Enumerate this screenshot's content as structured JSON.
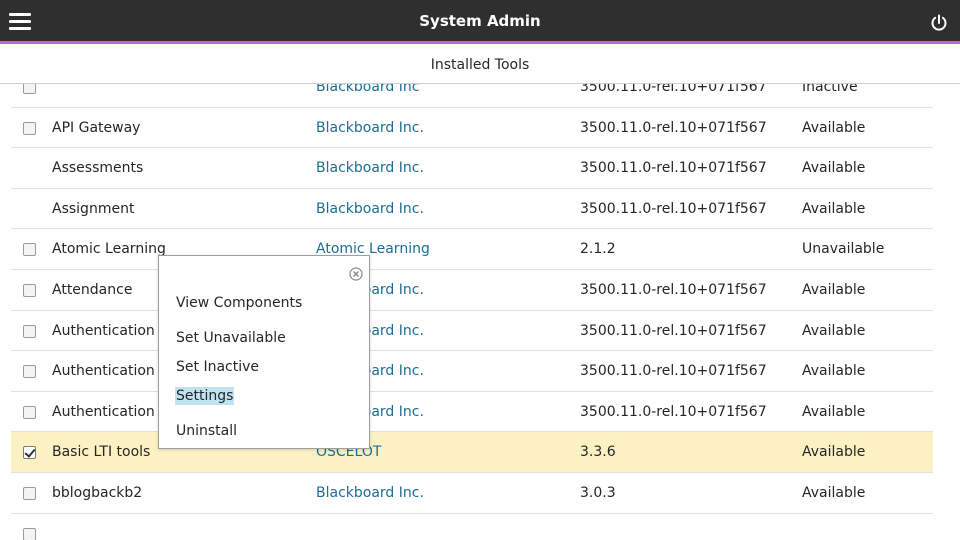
{
  "header": {
    "title": "System Admin",
    "menu_icon": "hamburger-menu-icon",
    "power_icon": "power-icon",
    "bg_color": "#2f2f2f",
    "accent_color": "#b36bd0"
  },
  "subheader": {
    "title": "Installed Tools"
  },
  "table": {
    "rows": [
      {
        "name": "",
        "vendor": "Blackboard Inc",
        "version": "3500.11.0-rel.10+071f567",
        "status": "Inactive",
        "has_checkbox": true,
        "checked": false
      },
      {
        "name": "API Gateway",
        "vendor": "Blackboard Inc.",
        "version": "3500.11.0-rel.10+071f567",
        "status": "Available",
        "has_checkbox": true,
        "checked": false
      },
      {
        "name": "Assessments",
        "vendor": "Blackboard Inc.",
        "version": "3500.11.0-rel.10+071f567",
        "status": "Available",
        "has_checkbox": false,
        "checked": false
      },
      {
        "name": "Assignment",
        "vendor": "Blackboard Inc.",
        "version": "3500.11.0-rel.10+071f567",
        "status": "Available",
        "has_checkbox": false,
        "checked": false
      },
      {
        "name": "Atomic Learning",
        "vendor": "Atomic Learning",
        "version": "2.1.2",
        "status": "Unavailable",
        "has_checkbox": true,
        "checked": false
      },
      {
        "name": "Attendance",
        "vendor": "Blackboard Inc.",
        "version": "3500.11.0-rel.10+071f567",
        "status": "Available",
        "has_checkbox": true,
        "checked": false
      },
      {
        "name": "Authentication P",
        "vendor": "Blackboard Inc.",
        "version": "3500.11.0-rel.10+071f567",
        "status": "Available",
        "has_checkbox": true,
        "checked": false
      },
      {
        "name": "Authentication P",
        "vendor": "Blackboard Inc.",
        "version": "3500.11.0-rel.10+071f567",
        "status": "Available",
        "has_checkbox": true,
        "checked": false
      },
      {
        "name": "Authentication P",
        "vendor": "Blackboard Inc.",
        "version": "3500.11.0-rel.10+071f567",
        "status": "Available",
        "has_checkbox": true,
        "checked": false
      },
      {
        "name": "Basic LTI tools",
        "vendor": "OSCELOT",
        "version": "3.3.6",
        "status": "Available",
        "has_checkbox": true,
        "checked": true,
        "selected": true
      },
      {
        "name": "bblogbackb2",
        "vendor": "Blackboard Inc.",
        "version": "3.0.3",
        "status": "Available",
        "has_checkbox": true,
        "checked": false
      },
      {
        "name": "",
        "vendor": "",
        "version": "",
        "status": "",
        "has_checkbox": true,
        "checked": false
      }
    ]
  },
  "context_menu": {
    "close_icon": "close-circle-icon",
    "items": {
      "view_components": "View Components",
      "set_unavailable": "Set Unavailable",
      "set_inactive": "Set Inactive",
      "settings": "Settings",
      "uninstall": "Uninstall"
    },
    "highlight_color": "#bfe3f0"
  },
  "colors": {
    "link": "#1c6e96",
    "selected_row": "#fcf1c2"
  }
}
